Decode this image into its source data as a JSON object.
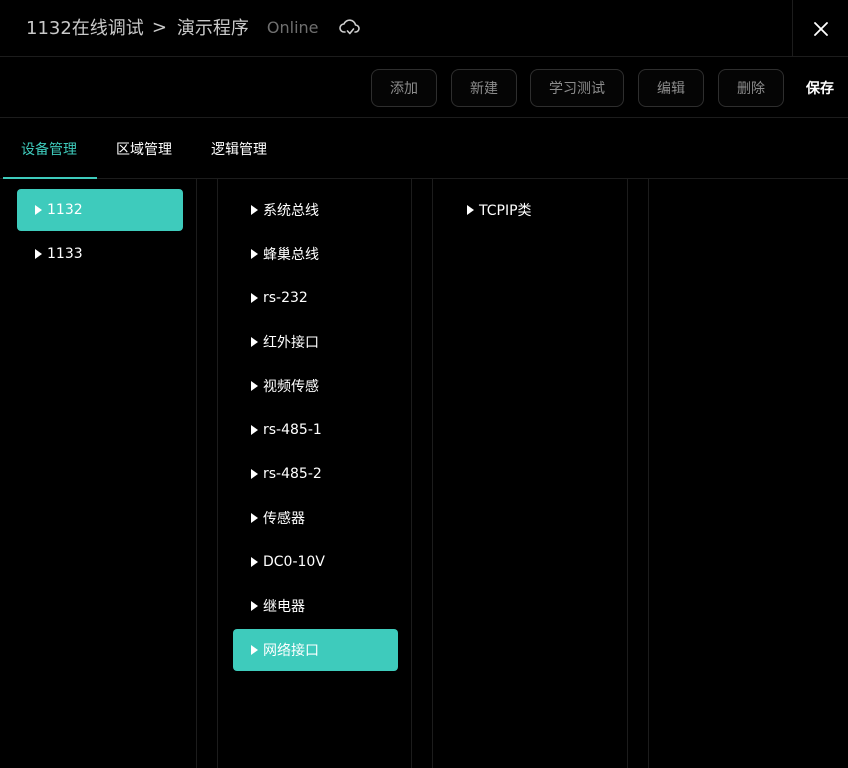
{
  "header": {
    "breadcrumb_root": "1132在线调试",
    "breadcrumb_sep": ">",
    "breadcrumb_current": "演示程序",
    "status": "Online"
  },
  "toolbar": {
    "add_label": "添加",
    "new_label": "新建",
    "learn_test_label": "学习测试",
    "edit_label": "编辑",
    "delete_label": "删除",
    "save_label": "保存"
  },
  "tabs": [
    {
      "label": "设备管理",
      "active": true
    },
    {
      "label": "区域管理",
      "active": false
    },
    {
      "label": "逻辑管理",
      "active": false
    }
  ],
  "devices": [
    {
      "label": "1132",
      "selected": true
    },
    {
      "label": "1133",
      "selected": false
    }
  ],
  "interfaces": [
    {
      "label": "系统总线",
      "selected": false
    },
    {
      "label": "蜂巢总线",
      "selected": false
    },
    {
      "label": "rs-232",
      "selected": false
    },
    {
      "label": "红外接口",
      "selected": false
    },
    {
      "label": "视频传感",
      "selected": false
    },
    {
      "label": "rs-485-1",
      "selected": false
    },
    {
      "label": "rs-485-2",
      "selected": false
    },
    {
      "label": "传感器",
      "selected": false
    },
    {
      "label": "DC0-10V",
      "selected": false
    },
    {
      "label": "继电器",
      "selected": false
    },
    {
      "label": "网络接口",
      "selected": true
    }
  ],
  "protocols": [
    {
      "label": "TCPIP类",
      "selected": false
    }
  ],
  "colors": {
    "accent": "#3ecbbc",
    "background": "#000000",
    "border": "#1c1c1c"
  }
}
